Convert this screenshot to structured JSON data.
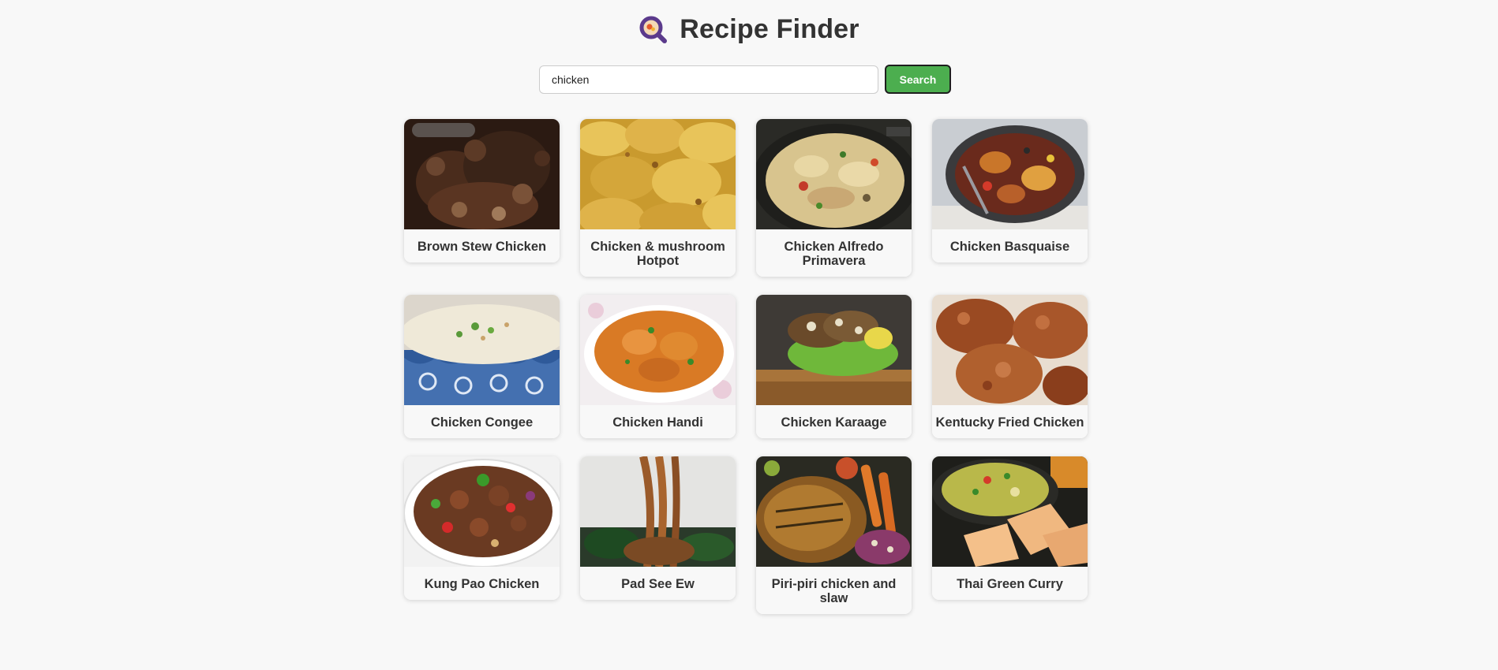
{
  "app": {
    "title": "Recipe Finder",
    "logo_icon": "magnifier-pan-icon"
  },
  "search": {
    "value": "chicken",
    "button_label": "Search"
  },
  "recipes": [
    {
      "title": "Brown Stew Chicken",
      "image": "brown-stew-image"
    },
    {
      "title": "Chicken & mushroom Hotpot",
      "image": "hotpot-image"
    },
    {
      "title": "Chicken Alfredo Primavera",
      "image": "alfredo-image"
    },
    {
      "title": "Chicken Basquaise",
      "image": "basquaise-image"
    },
    {
      "title": "Chicken Congee",
      "image": "congee-image"
    },
    {
      "title": "Chicken Handi",
      "image": "handi-image"
    },
    {
      "title": "Chicken Karaage",
      "image": "karaage-image"
    },
    {
      "title": "Kentucky Fried Chicken",
      "image": "kfc-image"
    },
    {
      "title": "Kung Pao Chicken",
      "image": "kung-pao-image"
    },
    {
      "title": "Pad See Ew",
      "image": "pad-see-ew-image"
    },
    {
      "title": "Piri-piri chicken and slaw",
      "image": "piri-piri-image"
    },
    {
      "title": "Thai Green Curry",
      "image": "green-curry-image"
    }
  ],
  "colors": {
    "background": "#f8f8f8",
    "button": "#4cae4f",
    "logo_accent": "#5b3a8c"
  }
}
